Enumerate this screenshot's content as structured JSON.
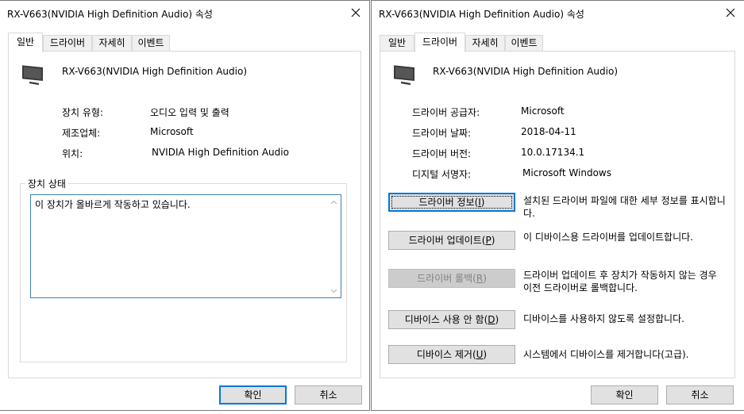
{
  "left_dialog": {
    "title": "RX-V663(NVIDIA High Definition Audio) 속성",
    "tabs": [
      {
        "label": "일반",
        "active": true
      },
      {
        "label": "드라이버",
        "active": false
      },
      {
        "label": "자세히",
        "active": false
      },
      {
        "label": "이벤트",
        "active": false
      }
    ],
    "device_name": "RX-V663(NVIDIA High Definition Audio)",
    "properties": [
      {
        "label": "장치 유형:",
        "value": "오디오 입력 및 출력"
      },
      {
        "label": "제조업체:",
        "value": "Microsoft"
      },
      {
        "label": "위치:",
        "value": "NVIDIA High Definition Audio"
      }
    ],
    "status_group_label": "장치 상태",
    "status_text": "이 장치가 올바르게 작동하고 있습니다.",
    "ok_label": "확인",
    "cancel_label": "취소"
  },
  "right_dialog": {
    "title": "RX-V663(NVIDIA High Definition Audio) 속성",
    "tabs": [
      {
        "label": "일반",
        "active": false
      },
      {
        "label": "드라이버",
        "active": true
      },
      {
        "label": "자세히",
        "active": false
      },
      {
        "label": "이벤트",
        "active": false
      }
    ],
    "device_name": "RX-V663(NVIDIA High Definition Audio)",
    "properties": [
      {
        "label": "드라이버 공급자:",
        "value": "Microsoft"
      },
      {
        "label": "드라이버 날짜:",
        "value": "2018-04-11"
      },
      {
        "label": "드라이버 버전:",
        "value": "10.0.17134.1"
      },
      {
        "label": "디지털 서명자:",
        "value": "Microsoft Windows"
      }
    ],
    "actions": [
      {
        "label": "드라이버 정보",
        "hotkey": "I",
        "description": "설치된 드라이버 파일에 대한 세부 정보를 표시합니다.",
        "disabled": false,
        "focused": true
      },
      {
        "label": "드라이버 업데이트",
        "hotkey": "P",
        "description": "이 디바이스용 드라이버를 업데이트합니다.",
        "disabled": false,
        "focused": false
      },
      {
        "label": "드라이버 롤백",
        "hotkey": "R",
        "description": "드라이버 업데이트 후 장치가 작동하지 않는 경우 이전 드라이버로 롤백합니다.",
        "disabled": true,
        "focused": false
      },
      {
        "label": "디바이스 사용 안 함",
        "hotkey": "D",
        "description": "디바이스를 사용하지 않도록 설정합니다.",
        "disabled": false,
        "focused": false
      },
      {
        "label": "디바이스 제거",
        "hotkey": "U",
        "description": "시스템에서 디바이스를 제거합니다(고급).",
        "disabled": false,
        "focused": false
      }
    ],
    "ok_label": "확인",
    "cancel_label": "취소"
  }
}
